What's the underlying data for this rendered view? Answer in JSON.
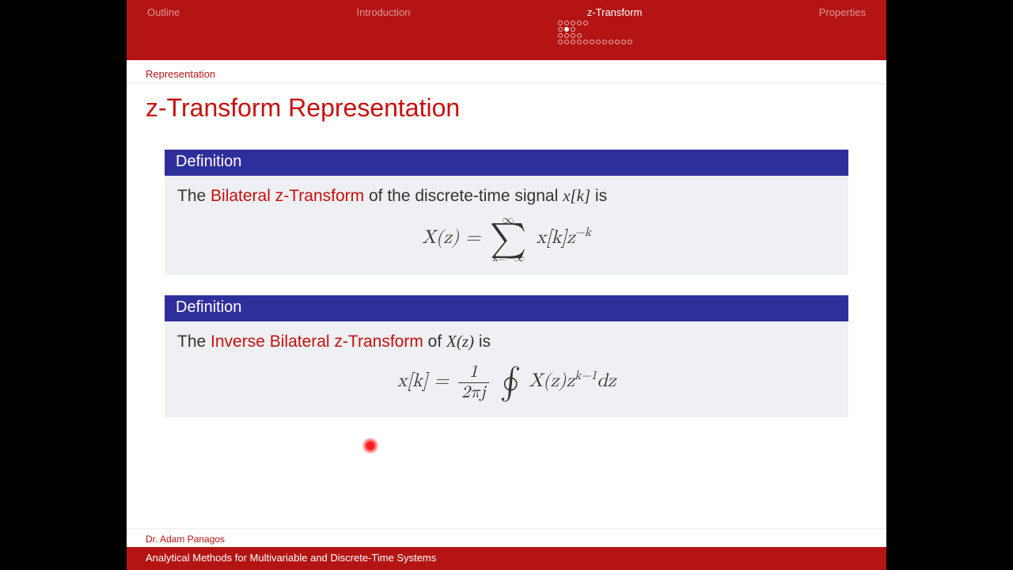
{
  "nav": {
    "items": [
      "Outline",
      "Introduction",
      "z-Transform",
      "Properties"
    ],
    "active_index": 2
  },
  "subheader": "Representation",
  "title": "z-Transform Representation",
  "def1": {
    "head": "Definition",
    "pre": "The ",
    "term": "Bilateral z-Transform",
    "post": " of the discrete-time signal ",
    "sig": "x[k]",
    "tail": " is",
    "formula_lhs": "X(z) = ",
    "sum_top": "∞",
    "sum_bot": "k=−∞",
    "sum_body": "x[k]z",
    "sum_exp": "−k"
  },
  "def2": {
    "head": "Definition",
    "pre": "The ",
    "term": "Inverse Bilateral z-Transform",
    "post": " of ",
    "sig": "X(z)",
    "tail": " is",
    "formula_lhs": "x[k] = ",
    "frac_num": "1",
    "frac_den": "2πj",
    "int_body": " X(z)z",
    "int_exp": "k−1",
    "int_tail": "dz"
  },
  "footer": {
    "author": "Dr. Adam Panagos",
    "course": "Analytical Methods for Multivariable and Discrete-Time Systems"
  }
}
